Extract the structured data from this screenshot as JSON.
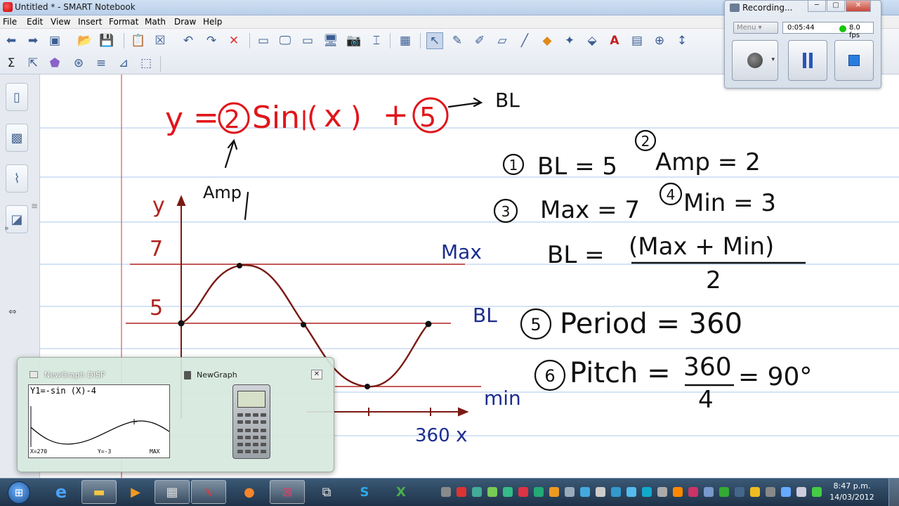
{
  "window": {
    "title": "Untitled * - SMART Notebook"
  },
  "menu": [
    "File",
    "Edit",
    "View",
    "Insert",
    "Format",
    "Math",
    "Draw",
    "Help"
  ],
  "toolbar": {
    "row1_icons": [
      "back-icon",
      "forward-icon",
      "add-page-icon",
      "open-icon",
      "save-icon",
      "paste-icon",
      "delete-page-icon",
      "undo-icon",
      "redo-icon",
      "delete-icon",
      "screen-shade-icon",
      "full-screen-icon",
      "dual-display-icon",
      "capture-icon",
      "document-camera-icon",
      "table-icon",
      "select-icon",
      "pen-icon",
      "creative-pen-icon",
      "eraser-icon",
      "line-icon",
      "shapes-icon",
      "magic-pen-icon",
      "fill-icon",
      "text-icon",
      "properties-icon",
      "measurement-icon",
      "move-toolbar-icon"
    ],
    "row2_icons": [
      "sum-icon",
      "arrow-tool-icon",
      "gallery-tool-icon",
      "math-tool-icon",
      "equation-icon",
      "graph-icon",
      "addon-icon"
    ]
  },
  "sidebar": {
    "tabs": [
      "page-sorter-icon",
      "gallery-icon",
      "attachments-icon",
      "properties-icon"
    ]
  },
  "recording": {
    "title": "Recording...",
    "menu_label": "Menu",
    "elapsed": "0:05:44",
    "fps": "8.0 fps",
    "buttons": [
      "record",
      "pause",
      "stop"
    ]
  },
  "whiteboard": {
    "equation": {
      "y": "y",
      "eq": "=",
      "amp": "2",
      "sin": "Sin",
      "x": "x",
      "plus": "+",
      "shift": "5",
      "arrow_label": "BL",
      "amp_label": "Amp"
    },
    "notes": {
      "n1": "BL = 5",
      "n2": "Amp = 2",
      "n3": "Max = 7",
      "n4": "Min = 3",
      "bl_formula_left": "BL =",
      "bl_formula_num": "(Max + Min)",
      "bl_formula_den": "2",
      "n5": "Period = 360",
      "n6_left": "Pitch =",
      "n6_num": "360",
      "n6_den": "4",
      "n6_right": "= 90°",
      "circles": [
        "1",
        "2",
        "3",
        "4",
        "5",
        "6"
      ]
    },
    "graph": {
      "y_axis_label": "y",
      "y_ticks": [
        "7",
        "5"
      ],
      "line_labels": {
        "max": "Max",
        "bl": "BL",
        "min": "min"
      },
      "x_tick_label": "360",
      "x_axis_label": "x"
    }
  },
  "newgraph": {
    "tab1": "NewGraph DISP",
    "tab2": "NewGraph",
    "close": "✕",
    "screen_line1": "Y1=-sin (X)-4",
    "footer_x": "X=270",
    "footer_y": "Y=-3",
    "footer_max": "MAX"
  },
  "taskbar": {
    "apps": [
      "ie-icon",
      "explorer-icon",
      "media-player-icon",
      "calculator-icon",
      "smart-notebook-icon",
      "firefox-icon",
      "recorder-icon",
      "network-icon",
      "skype-icon",
      "excel-icon"
    ],
    "clock_time": "8:47 p.m.",
    "clock_date": "14/03/2012"
  },
  "colors": {
    "red_ink": "#e0161b",
    "dark_ink": "#111111",
    "blue_ink": "#1c2d8e",
    "curve": "#7a1a14",
    "margin": "#e55",
    "rule": "#a9c8ee"
  }
}
